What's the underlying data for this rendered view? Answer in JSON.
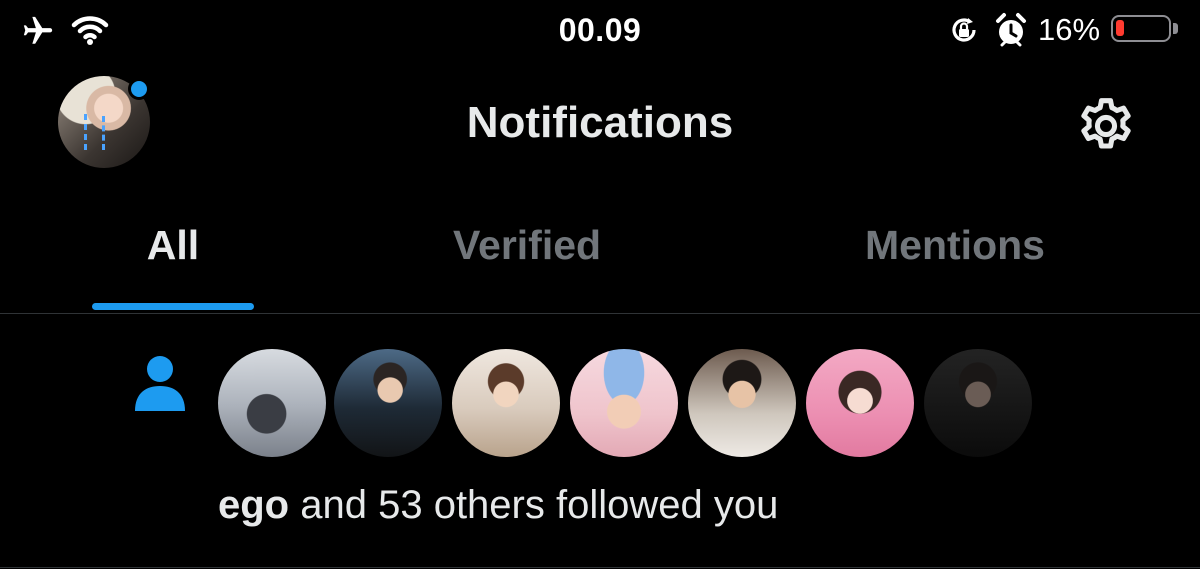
{
  "status_bar": {
    "time": "00.09",
    "battery_percent": "16%",
    "battery_level": 0.16,
    "icons": [
      "airplane-icon",
      "wifi-icon",
      "rotation-lock-icon",
      "alarm-icon",
      "battery-icon"
    ]
  },
  "header": {
    "title": "Notifications",
    "has_unread_dot": true,
    "settings_icon": "gear-icon"
  },
  "tabs": [
    {
      "label": "All",
      "active": true
    },
    {
      "label": "Verified",
      "active": false
    },
    {
      "label": "Mentions",
      "active": false
    }
  ],
  "notification": {
    "type_icon": "person-icon",
    "actor": "ego",
    "rest_text": " and 53 others followed you",
    "follower_count_shown": 7
  },
  "colors": {
    "background": "#000000",
    "accent": "#1d9bf0",
    "text_primary": "#e7e9ea",
    "text_secondary": "#71767b",
    "battery_low": "#ff3b30"
  }
}
